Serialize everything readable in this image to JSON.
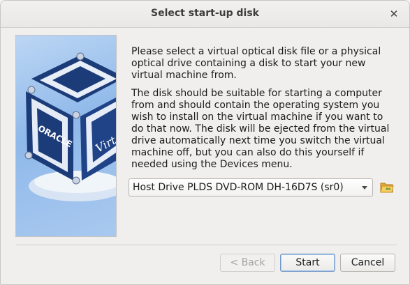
{
  "window": {
    "title": "Select start-up disk",
    "close_glyph": "✕"
  },
  "art": {
    "logo_text_1": "ORACLE",
    "logo_text_2": "Virt",
    "icon": "virtualbox-cube-logo"
  },
  "content": {
    "paragraph1": "Please select a virtual optical disk file or a physical optical drive containing a disk to start your new virtual machine from.",
    "paragraph2": "The disk should be suitable for starting a computer from and should contain the operating system you wish to install on the virtual machine if you want to do that now. The disk will be ejected from the virtual drive automatically next time you switch the virtual machine off, but you can also do this yourself if needed using the Devices menu."
  },
  "drive_select": {
    "selected": "Host Drive PLDS DVD-ROM DH-16D7S (sr0)",
    "icon": "chevron-down-icon"
  },
  "folder_button": {
    "icon": "folder-open-icon"
  },
  "buttons": {
    "back": "< Back",
    "start": "Start",
    "cancel": "Cancel"
  },
  "colors": {
    "accent": "#6f97c9",
    "window_bg": "#f0efee",
    "art_bg": "#8fb9ea"
  }
}
